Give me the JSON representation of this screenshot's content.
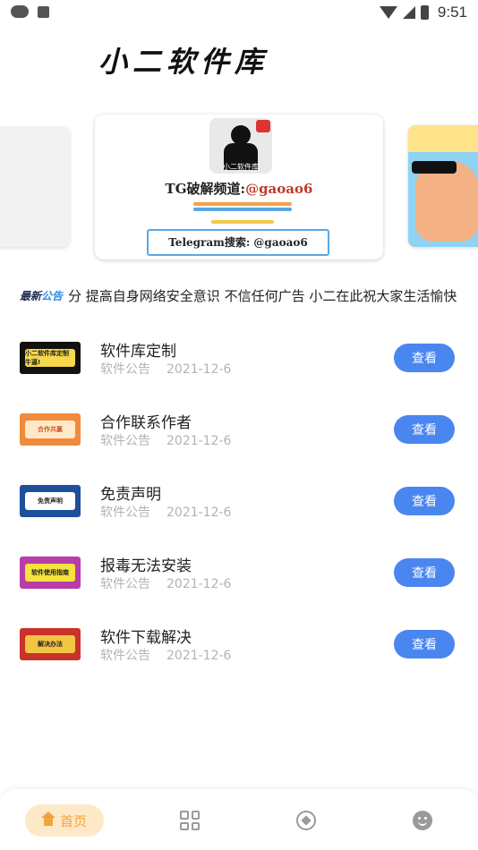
{
  "status_bar": {
    "time": "9:51",
    "icons": [
      "cloud-icon",
      "font-a-icon",
      "wifi-icon",
      "signal-icon",
      "battery-icon"
    ]
  },
  "app": {
    "logo_text": "小二软件库"
  },
  "banner": {
    "avatar_caption": "小二软件库",
    "title_prefix": "TG破解频道:",
    "title_handle": "@gaoao6",
    "search_text": "Telegram搜索: @gaoao6"
  },
  "notice": {
    "tag_dark": "最新",
    "tag_blue": "公告",
    "text": "分 提高自身网络安全意识 不信任何广告 小二在此祝大家生活愉快"
  },
  "articles": [
    {
      "title": "软件库定制",
      "category": "软件公告",
      "date": "2021-12-6",
      "button": "查看",
      "thumb_text": "小二软件库定制 牛逼!"
    },
    {
      "title": "合作联系作者",
      "category": "软件公告",
      "date": "2021-12-6",
      "button": "查看",
      "thumb_text": "合作共赢"
    },
    {
      "title": "免责声明",
      "category": "软件公告",
      "date": "2021-12-6",
      "button": "查看",
      "thumb_text": "免责声明"
    },
    {
      "title": "报毒无法安装",
      "category": "软件公告",
      "date": "2021-12-6",
      "button": "查看",
      "thumb_text": "软件使用指南"
    },
    {
      "title": "软件下载解决",
      "category": "软件公告",
      "date": "2021-12-6",
      "button": "查看",
      "thumb_text": "解决办法"
    }
  ],
  "colors": {
    "accent_blue": "#4a86f0",
    "home_active_bg": "#fde9c8",
    "home_active_fg": "#f2a33b"
  },
  "bottom_nav": {
    "home_label": "首页",
    "icons": [
      "home-icon",
      "grid-icon",
      "compass-icon",
      "smile-icon"
    ]
  }
}
